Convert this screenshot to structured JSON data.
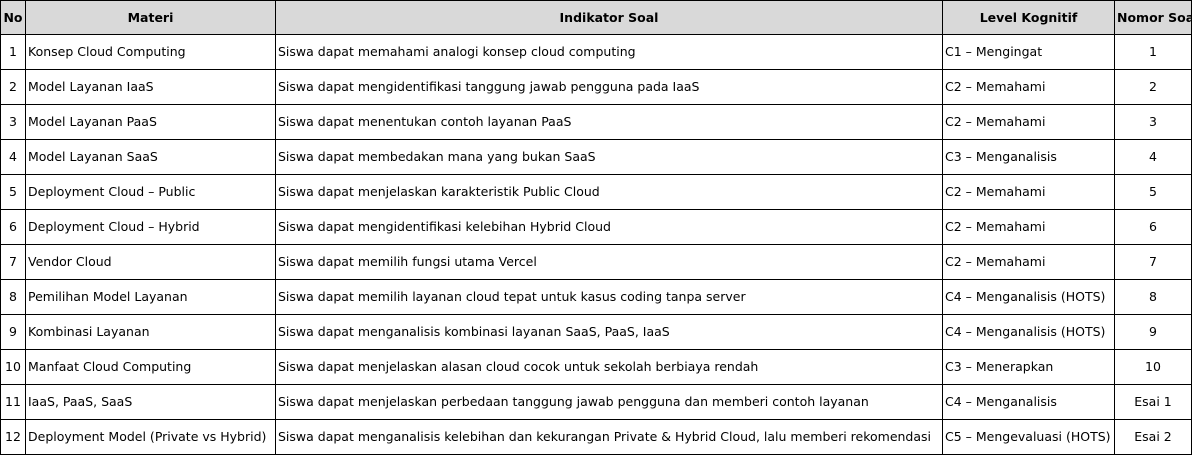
{
  "headers": {
    "no": "No",
    "materi": "Materi",
    "indikator": "Indikator Soal",
    "level": "Level Kognitif",
    "nomor": "Nomor Soal"
  },
  "rows": [
    {
      "no": "1",
      "materi": "Konsep Cloud Computing",
      "indikator": "Siswa dapat memahami analogi konsep cloud computing",
      "level": "C1 – Mengingat",
      "nomor": "1"
    },
    {
      "no": "2",
      "materi": "Model Layanan IaaS",
      "indikator": "Siswa dapat mengidentifikasi tanggung jawab pengguna pada IaaS",
      "level": "C2 – Memahami",
      "nomor": "2"
    },
    {
      "no": "3",
      "materi": "Model Layanan PaaS",
      "indikator": "Siswa dapat menentukan contoh layanan PaaS",
      "level": "C2 – Memahami",
      "nomor": "3"
    },
    {
      "no": "4",
      "materi": "Model Layanan SaaS",
      "indikator": "Siswa dapat membedakan mana yang bukan SaaS",
      "level": "C3 – Menganalisis",
      "nomor": "4"
    },
    {
      "no": "5",
      "materi": "Deployment Cloud – Public",
      "indikator": "Siswa dapat menjelaskan karakteristik Public Cloud",
      "level": "C2 – Memahami",
      "nomor": "5"
    },
    {
      "no": "6",
      "materi": "Deployment Cloud – Hybrid",
      "indikator": "Siswa dapat mengidentifikasi kelebihan Hybrid Cloud",
      "level": "C2 – Memahami",
      "nomor": "6"
    },
    {
      "no": "7",
      "materi": "Vendor Cloud",
      "indikator": "Siswa dapat memilih fungsi utama Vercel",
      "level": "C2 – Memahami",
      "nomor": "7"
    },
    {
      "no": "8",
      "materi": "Pemilihan Model Layanan",
      "indikator": "Siswa dapat memilih layanan cloud tepat untuk kasus coding tanpa server",
      "level": "C4 – Menganalisis (HOTS)",
      "nomor": "8"
    },
    {
      "no": "9",
      "materi": "Kombinasi Layanan",
      "indikator": "Siswa dapat menganalisis kombinasi layanan SaaS, PaaS, IaaS",
      "level": "C4 – Menganalisis (HOTS)",
      "nomor": "9"
    },
    {
      "no": "10",
      "materi": "Manfaat Cloud Computing",
      "indikator": "Siswa dapat menjelaskan alasan cloud cocok untuk sekolah berbiaya rendah",
      "level": "C3 – Menerapkan",
      "nomor": "10"
    },
    {
      "no": "11",
      "materi": "IaaS, PaaS, SaaS",
      "indikator": "Siswa dapat menjelaskan perbedaan tanggung jawab pengguna dan memberi contoh layanan",
      "level": "C4 – Menganalisis",
      "nomor": "Esai 1"
    },
    {
      "no": "12",
      "materi": "Deployment Model (Private vs Hybrid)",
      "indikator": "Siswa dapat menganalisis kelebihan dan kekurangan Private & Hybrid Cloud, lalu memberi rekomendasi",
      "level": "C5 – Mengevaluasi (HOTS)",
      "nomor": "Esai 2"
    }
  ]
}
